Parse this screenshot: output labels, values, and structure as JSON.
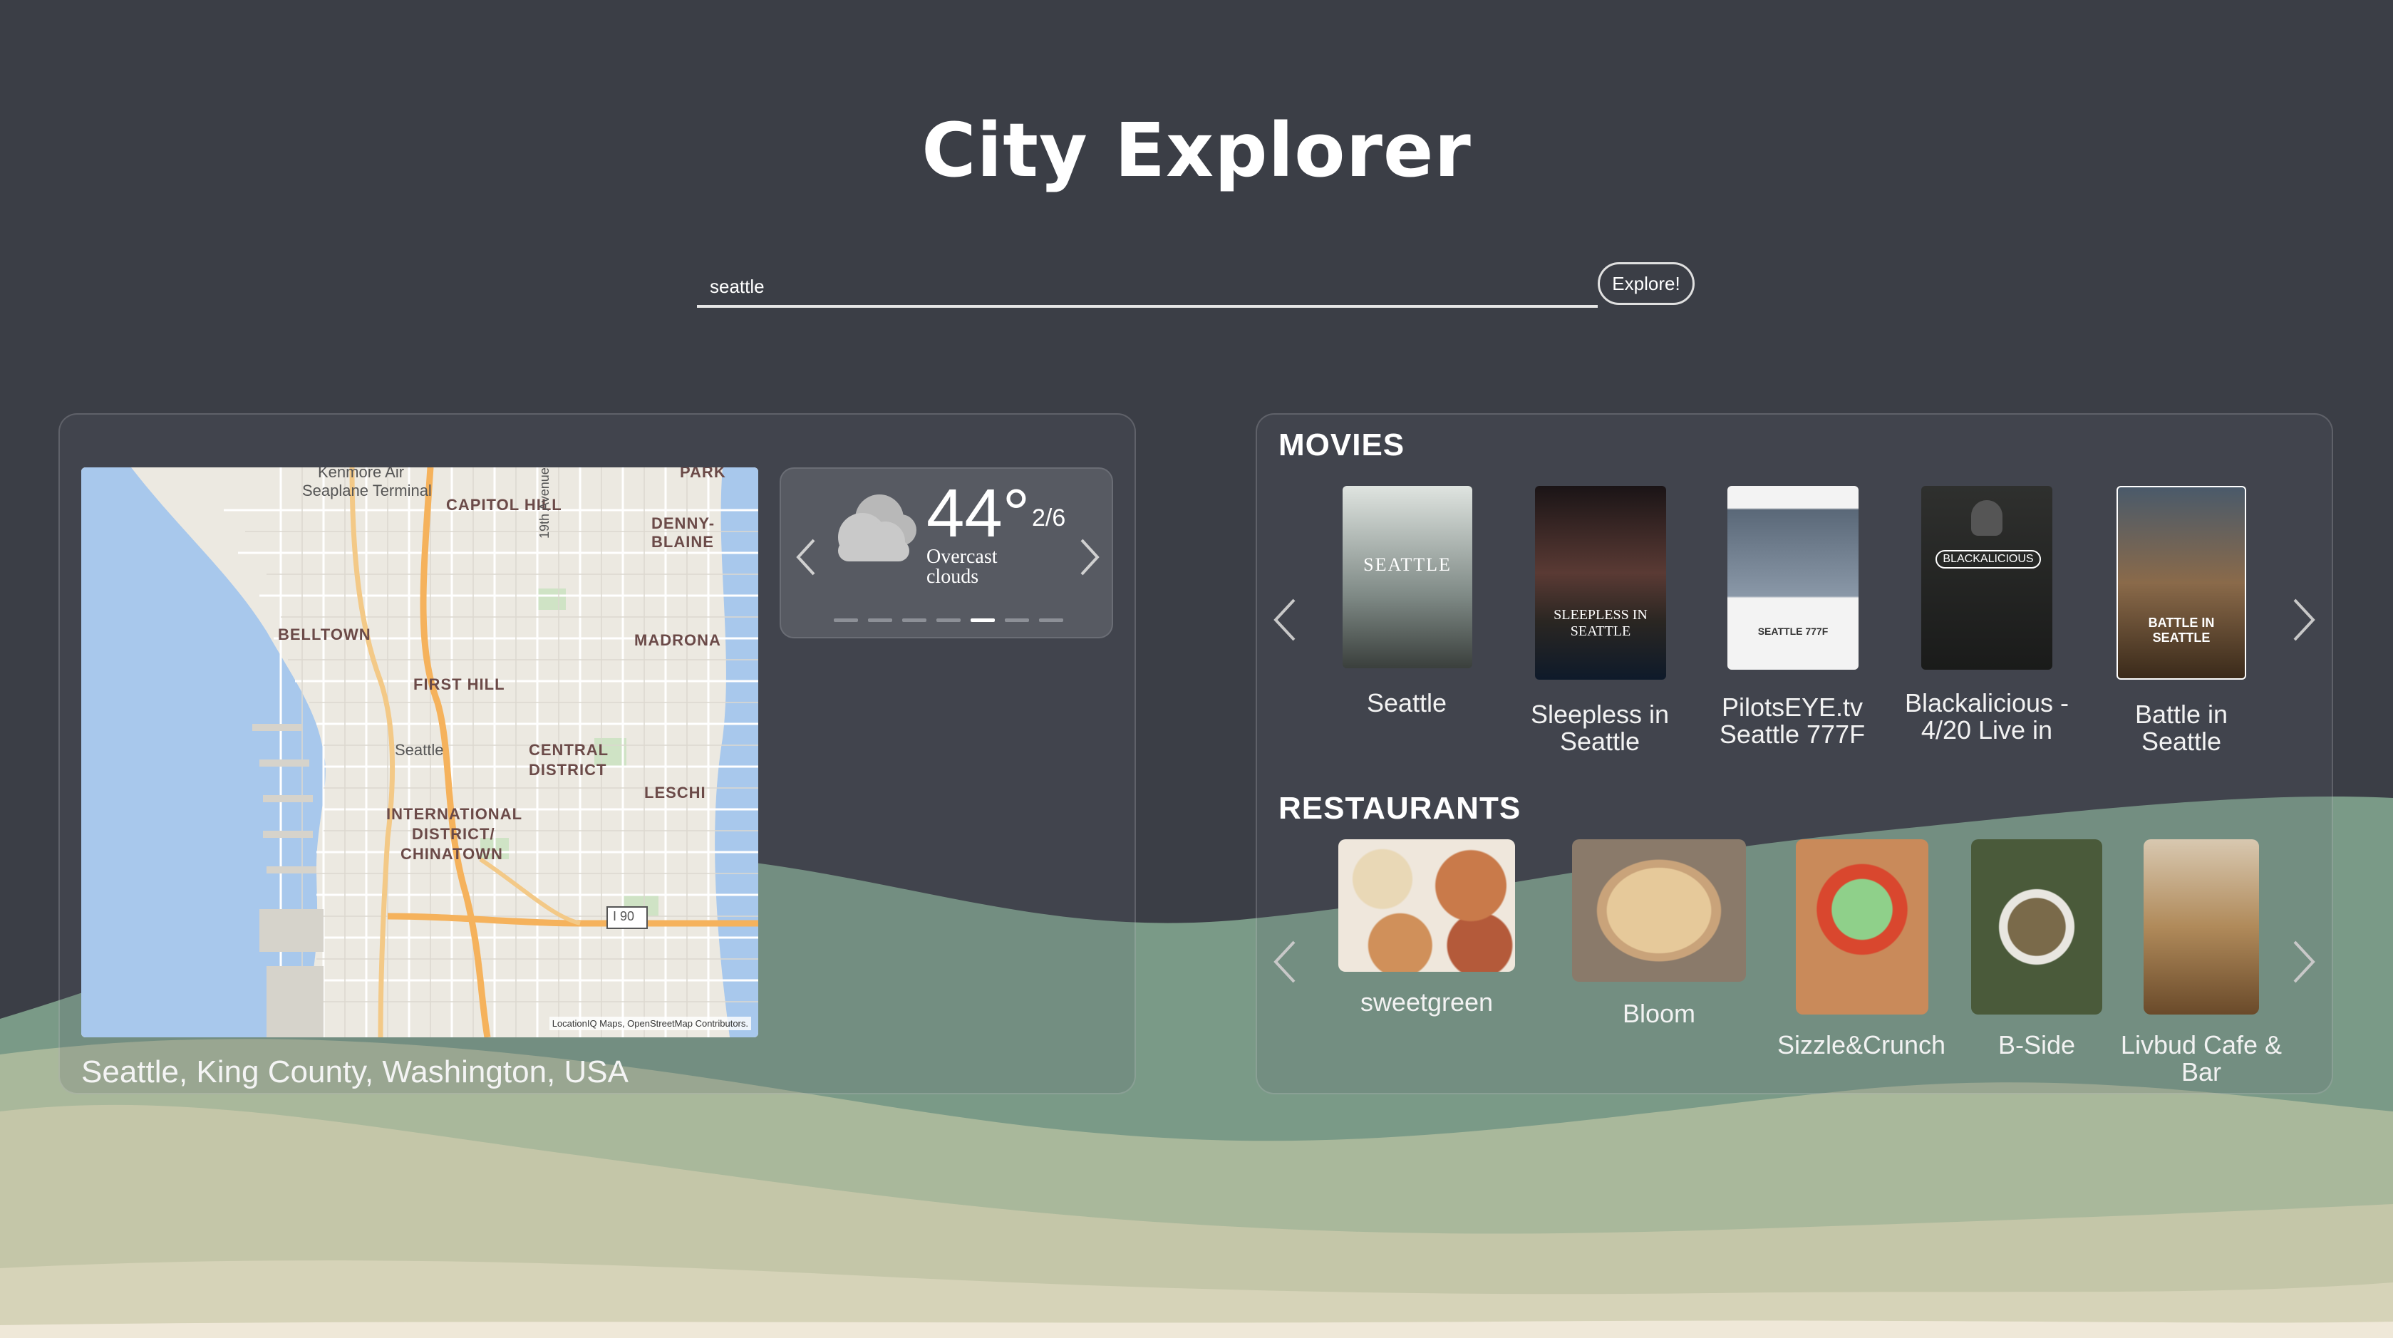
{
  "app": {
    "title": "City Explorer"
  },
  "search": {
    "value": "seattle",
    "button_label": "Explore!"
  },
  "map": {
    "labels": {
      "kenmore": "Kenmore Air",
      "seaplane": "Seaplane Terminal",
      "capitol_hill": "CAPITOL HILL",
      "park": "PARK",
      "denny_blaine": "DENNY-BLAINE",
      "belltown": "BELLTOWN",
      "madrona": "MADRONA",
      "first_hill": "FIRST HILL",
      "seattle": "Seattle",
      "central": "CENTRAL",
      "district": "DISTRICT",
      "leschi": "LESCHI",
      "international": "INTERNATIONAL",
      "district2": "DISTRICT/",
      "chinatown": "CHINATOWN",
      "i90": "I 90",
      "avenue19": "19th Avenue"
    },
    "attribution": "LocationIQ Maps, OpenStreetMap Contributors."
  },
  "location": {
    "display_name": "Seattle, King County, Washington, USA"
  },
  "weather": {
    "temp": "44°",
    "page": "2/6",
    "description": "Overcast clouds",
    "icon": "cloud-icon",
    "total": 7,
    "active_index": 4
  },
  "movies": {
    "heading": "MOVIES",
    "items": [
      {
        "title": "Seattle",
        "poster_text": "SEATTLE"
      },
      {
        "title": "Sleepless in Seattle",
        "poster_text": "SLEEPLESS IN SEATTLE"
      },
      {
        "title": "PilotsEYE.tv Seattle 777F",
        "poster_text": "SEATTLE 777F"
      },
      {
        "title": "Blackalicious - 4/20 Live in",
        "poster_text": "BLACKALICIOUS"
      },
      {
        "title": "Battle in Seattle",
        "poster_text": "BATTLE IN SEATTLE"
      }
    ]
  },
  "restaurants": {
    "heading": "RESTAURANTS",
    "items": [
      {
        "name": "sweetgreen"
      },
      {
        "name": "Bloom"
      },
      {
        "name": "Sizzle&Crunch"
      },
      {
        "name": "B-Side"
      },
      {
        "name": "Livbud Cafe & Bar"
      }
    ]
  },
  "colors": {
    "background": "#3b3e46",
    "wave_dark": "#7a9a87",
    "wave_mid": "#a9b89b",
    "wave_light": "#d6d3b8",
    "wave_cream": "#efe8d8"
  }
}
